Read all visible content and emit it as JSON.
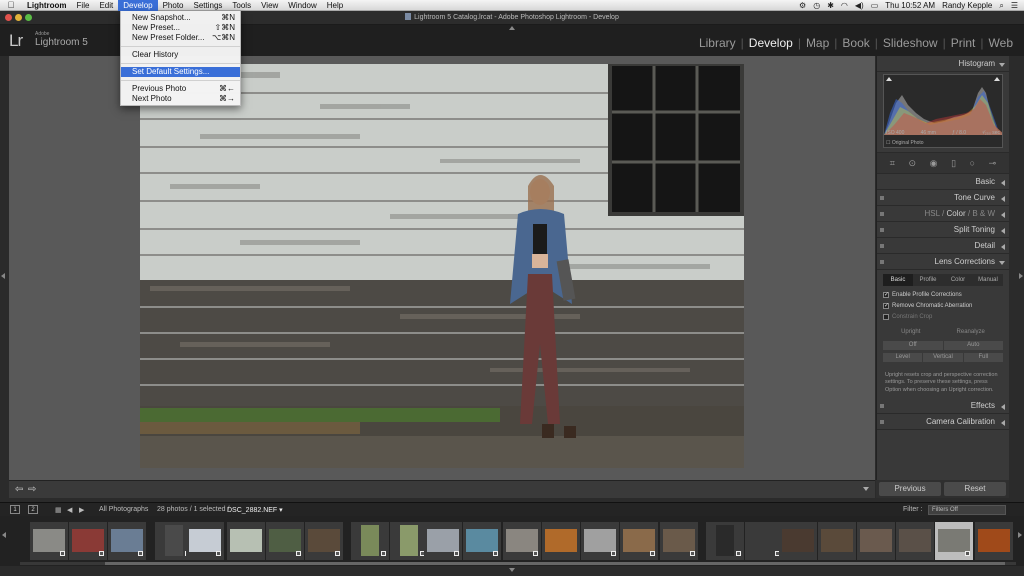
{
  "menubar": {
    "apple": "",
    "items": [
      "Lightroom",
      "File",
      "Edit",
      "Develop",
      "Photo",
      "Settings",
      "Tools",
      "View",
      "Window",
      "Help"
    ],
    "clock": "Thu 10:52 AM",
    "user": "Randy Kepple"
  },
  "window": {
    "title": "Lightroom 5 Catalog.lrcat - Adobe Photoshop Lightroom - Develop"
  },
  "identity": {
    "logo": "Lr",
    "adobe": "Adobe",
    "product": "Lightroom 5",
    "modules": [
      "Library",
      "Develop",
      "Map",
      "Book",
      "Slideshow",
      "Print",
      "Web"
    ],
    "separator": "|",
    "active_module": "Develop"
  },
  "develop_menu": {
    "items": [
      {
        "label": "New Snapshot...",
        "shortcut": "⌘N"
      },
      {
        "label": "New Preset...",
        "shortcut": "⇧⌘N"
      },
      {
        "label": "New Preset Folder...",
        "shortcut": "⌥⌘N"
      },
      {
        "label": "Clear History",
        "shortcut": ""
      },
      {
        "label": "Set Default Settings...",
        "shortcut": ""
      },
      {
        "label": "Previous Photo",
        "shortcut": "⌘←"
      },
      {
        "label": "Next Photo",
        "shortcut": "⌘→"
      }
    ]
  },
  "right_panel": {
    "histogram_label": "Histogram",
    "meta": [
      "ISO 400",
      "46 mm",
      "ƒ / 8.0",
      "¹⁄₂₅₀ sec"
    ],
    "original_photo": "Original Photo",
    "sections": {
      "basic": "Basic",
      "tone_curve": "Tone Curve",
      "hsl": "HSL",
      "color": "Color",
      "bw": "B & W",
      "split_toning": "Split Toning",
      "detail": "Detail",
      "lens_corrections": "Lens Corrections",
      "effects": "Effects",
      "camera_calibration": "Camera Calibration"
    },
    "lens_tabs": [
      "Basic",
      "Profile",
      "Color",
      "Manual"
    ],
    "checkboxes": [
      {
        "label": "Enable Profile Corrections",
        "checked": true
      },
      {
        "label": "Remove Chromatic Aberration",
        "checked": true
      },
      {
        "label": "Constrain Crop",
        "checked": false
      }
    ],
    "upright": "Upright",
    "reanalyze": "Reanalyze",
    "upright_row1": [
      "Off",
      "Auto"
    ],
    "upright_row2": [
      "Level",
      "Vertical",
      "Full"
    ],
    "note": "Upright resets crop and perspective correction settings. To preserve these settings, press Option when choosing an Upright correction.",
    "buttons": {
      "previous": "Previous",
      "reset": "Reset"
    }
  },
  "filmstrip_bar": {
    "monitor1": "1",
    "monitor2": "2",
    "source": "All Photographs",
    "count": "28 photos / 1 selected /",
    "filename": "DSC_2882.NEF ▾",
    "filter_label": "Filter :",
    "filter_value": "Filters Off"
  },
  "colors": {
    "accent": "#3a6fd8",
    "panel": "#393939",
    "canvas": "#595959"
  }
}
